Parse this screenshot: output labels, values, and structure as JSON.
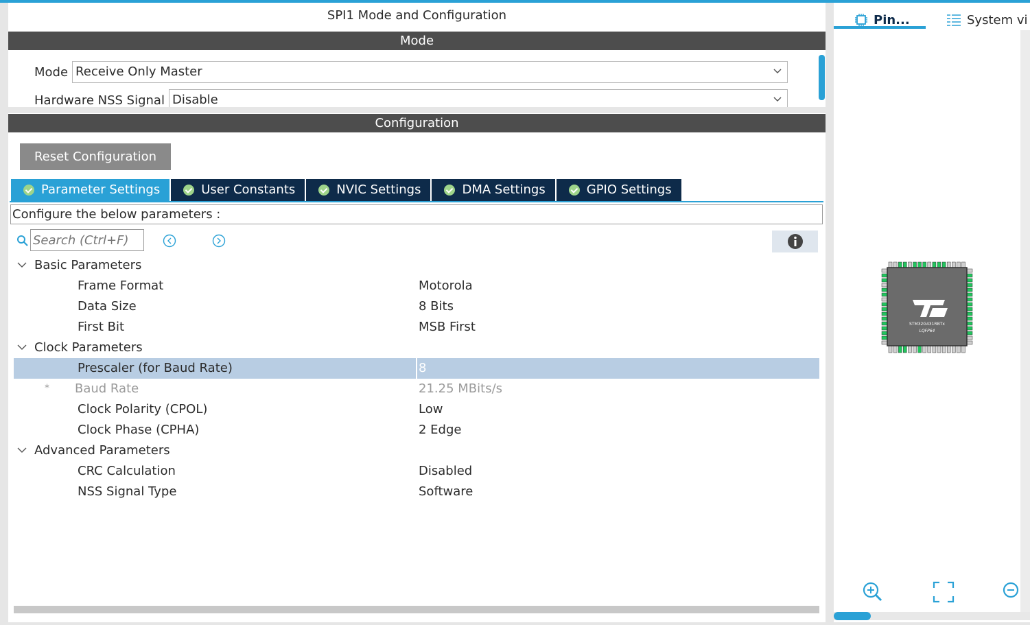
{
  "header": {
    "title": "SPI1 Mode and Configuration",
    "mode_band": "Mode",
    "config_band": "Configuration"
  },
  "mode": {
    "mode_label": "Mode",
    "mode_value": "Receive Only Master",
    "nss_label": "Hardware NSS Signal",
    "nss_value": "Disable"
  },
  "reset_label": "Reset Configuration",
  "tabs": [
    {
      "label": "Parameter Settings",
      "active": true
    },
    {
      "label": "User Constants",
      "active": false
    },
    {
      "label": "NVIC Settings",
      "active": false
    },
    {
      "label": "DMA Settings",
      "active": false
    },
    {
      "label": "GPIO Settings",
      "active": false
    }
  ],
  "configure_text": "Configure the below parameters :",
  "search": {
    "placeholder": "Search (Ctrl+F)"
  },
  "groups": [
    {
      "name": "Basic Parameters",
      "items": [
        {
          "name": "Frame Format",
          "value": "Motorola"
        },
        {
          "name": "Data Size",
          "value": "8 Bits"
        },
        {
          "name": "First Bit",
          "value": "MSB First"
        }
      ]
    },
    {
      "name": "Clock Parameters",
      "items": [
        {
          "name": "Prescaler (for Baud Rate)",
          "value": "8"
        },
        {
          "name": "Baud Rate",
          "value": "21.25 MBits/s",
          "marker": "*"
        },
        {
          "name": "Clock Polarity (CPOL)",
          "value": "Low"
        },
        {
          "name": "Clock Phase (CPHA)",
          "value": "2 Edge"
        }
      ]
    },
    {
      "name": "Advanced Parameters",
      "items": [
        {
          "name": "CRC Calculation",
          "value": "Disabled"
        },
        {
          "name": "NSS Signal Type",
          "value": "Software"
        }
      ]
    }
  ],
  "right_panel": {
    "tab_pin": "Pin...",
    "tab_system": "System vi",
    "chip_name": "STM32G431RBTx",
    "chip_package": "LQFP64"
  },
  "colors": {
    "accent": "#2aa1d6",
    "tab_dark": "#0e2b4a",
    "band": "#4d4d4d",
    "selected_row": "#b8cde3",
    "pin_green": "#22c55e"
  }
}
